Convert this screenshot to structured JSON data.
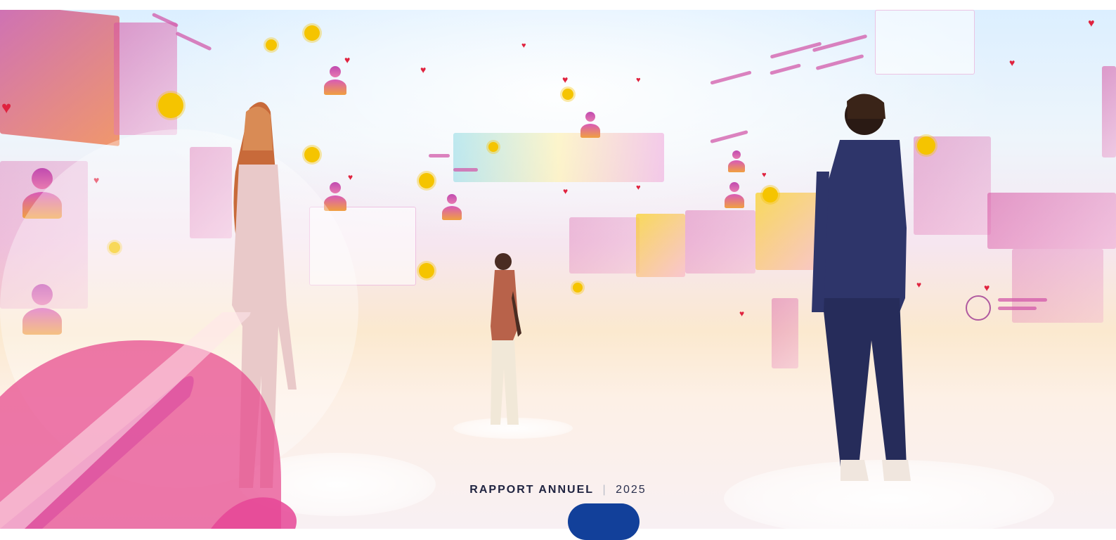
{
  "report": {
    "title": "RAPPORT ANNUEL",
    "separator": "|",
    "year": "2025"
  },
  "colors": {
    "accent_blue": "#12409a",
    "pink": "#e04b9c",
    "title_text": "#1f2340"
  },
  "icons": [
    "heart-icon",
    "user-icon",
    "avatar-icon"
  ]
}
